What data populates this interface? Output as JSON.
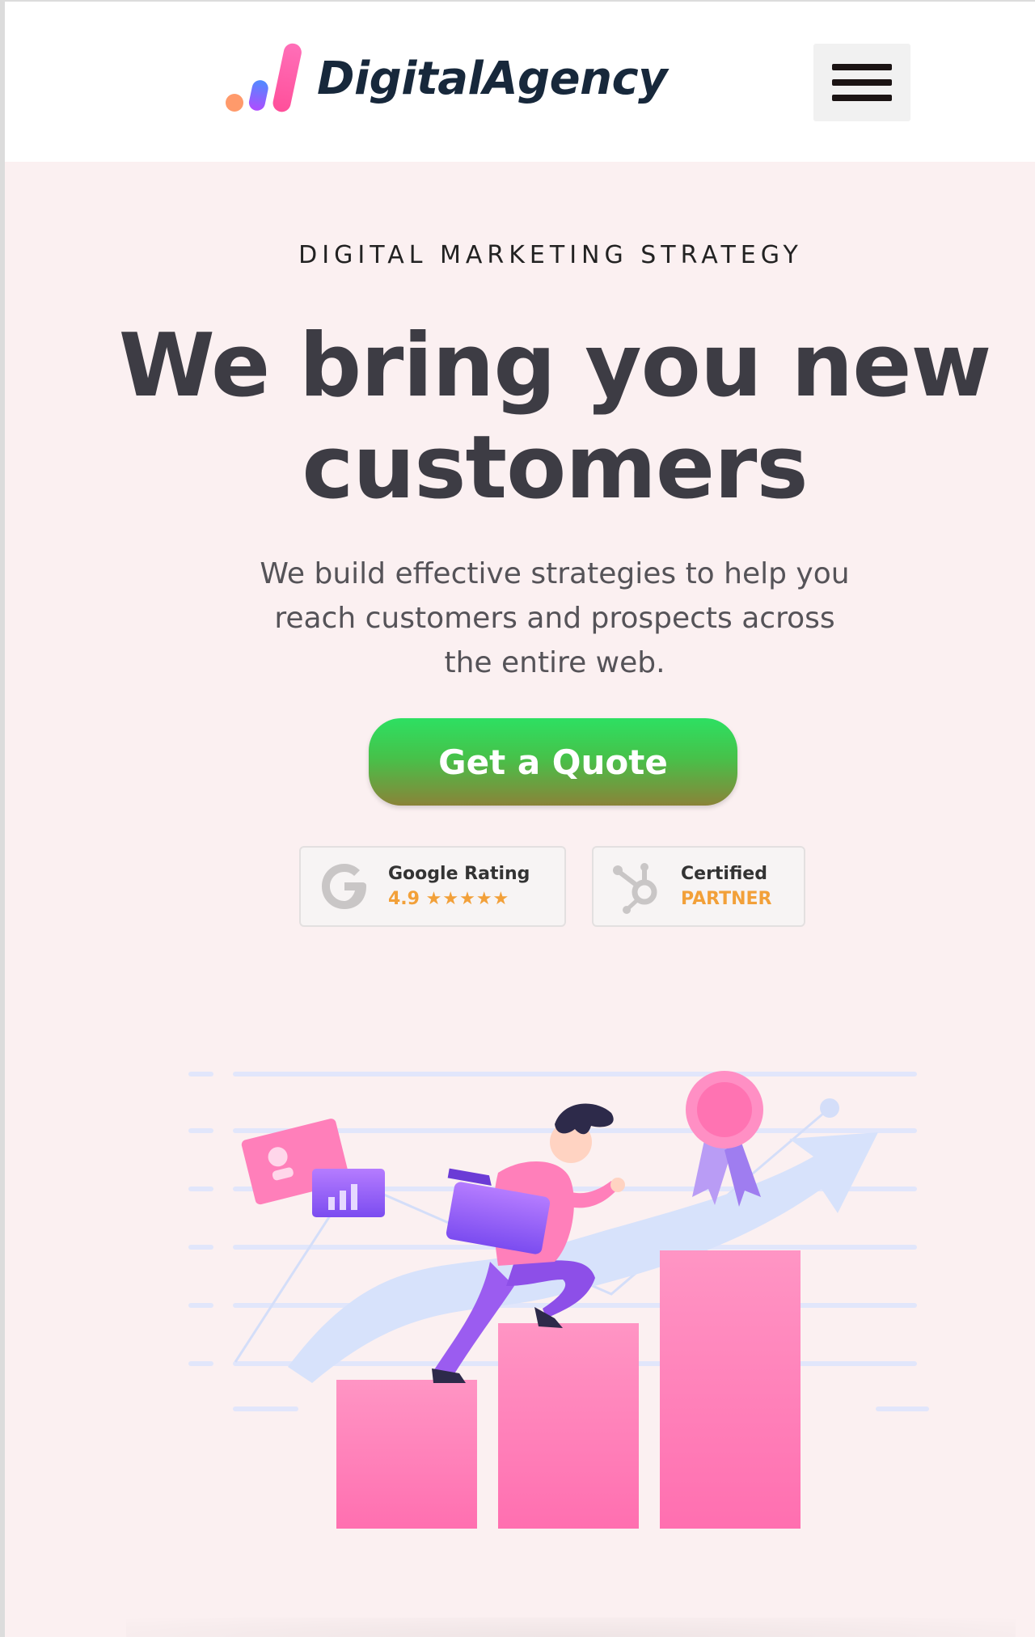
{
  "header": {
    "logo_text": "DigitalAgency",
    "logo_icon": "bar-chart-logo-icon",
    "menu_icon": "hamburger-menu-icon"
  },
  "hero": {
    "eyebrow": "DIGITAL MARKETING STRATEGY",
    "headline_line1": "We bring you new",
    "headline_line2": "customers",
    "subtext_line1": "We build effective strategies to help you",
    "subtext_line2": "reach customers and prospects across",
    "subtext_line3": "the entire web.",
    "cta_label": "Get a Quote"
  },
  "badges": [
    {
      "icon": "google-g-icon",
      "line1": "Google Rating",
      "rating": "4.9",
      "stars": "★★★★★"
    },
    {
      "icon": "hubspot-icon",
      "line1": "Certified",
      "line2": "PARTNER"
    }
  ],
  "illustration": {
    "icon": "growth-chart-illustration"
  },
  "colors": {
    "hero_bg": "#fbf0f1",
    "brand_navy": "#17283b",
    "cta_green": "#2de062",
    "accent_orange": "#f2a039",
    "bar_pink": "#ff7bb6",
    "accent_purple": "#9b5cf0"
  }
}
